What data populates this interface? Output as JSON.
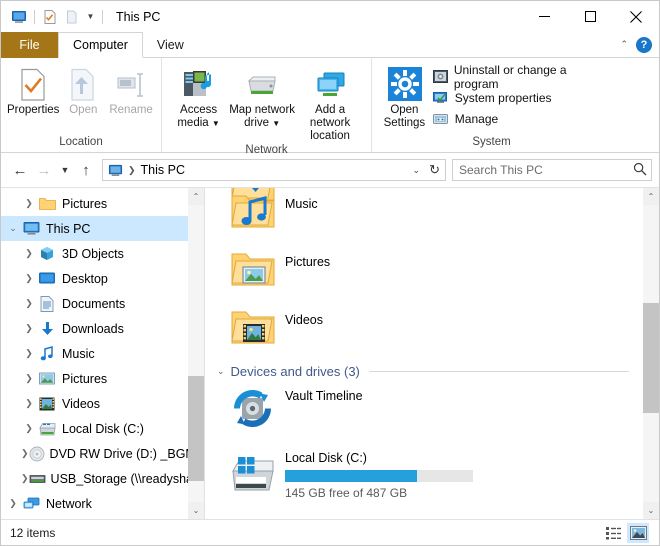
{
  "window": {
    "title": "This PC",
    "quick_access": [
      {
        "name": "this-pc-icon",
        "label": "This PC"
      },
      {
        "name": "properties-icon",
        "label": "Properties"
      },
      {
        "name": "new-folder-icon",
        "label": "New folder"
      }
    ],
    "controls": {
      "minimize": "Minimize",
      "maximize": "Maximize",
      "close": "Close"
    }
  },
  "tabs": [
    {
      "label": "File",
      "type": "file"
    },
    {
      "label": "Computer",
      "type": "active"
    },
    {
      "label": "View",
      "type": "normal"
    }
  ],
  "tab_right": {
    "collapse_label": "Collapse the Ribbon",
    "help_label": "?"
  },
  "ribbon": {
    "groups": [
      {
        "label": "Location",
        "buttons": [
          {
            "label": "Properties",
            "icon": "properties-icon",
            "disabled": false
          },
          {
            "label": "Open",
            "icon": "open-icon",
            "disabled": true
          },
          {
            "label": "Rename",
            "icon": "rename-icon",
            "disabled": true
          }
        ]
      },
      {
        "label": "Network",
        "buttons": [
          {
            "label": "Access media",
            "icon": "access-media-icon",
            "dropdown": true,
            "disabled": false
          },
          {
            "label": "Map network drive",
            "icon": "map-network-drive-icon",
            "dropdown": true,
            "disabled": false
          },
          {
            "label": "Add a network location",
            "icon": "add-network-location-icon",
            "dropdown": false,
            "disabled": false
          }
        ]
      },
      {
        "label": "System",
        "big_button": {
          "label_line1": "Open",
          "label_line2": "Settings",
          "icon": "gear-icon"
        },
        "small_buttons": [
          {
            "label": "Uninstall or change a program",
            "icon": "uninstall-icon"
          },
          {
            "label": "System properties",
            "icon": "system-properties-icon"
          },
          {
            "label": "Manage",
            "icon": "manage-icon"
          }
        ]
      }
    ]
  },
  "addressbar": {
    "back": "Back",
    "forward": "Forward",
    "recent": "Recent locations",
    "up": "Up",
    "breadcrumb_icon": "this-pc-icon",
    "breadcrumb": "This PC",
    "refresh": "Refresh",
    "search_placeholder": "Search This PC"
  },
  "navpane": {
    "items": [
      {
        "label": "Pictures",
        "icon": "folder-icon",
        "depth": 1,
        "expander": "collapsed",
        "selected": false
      },
      {
        "label": "This PC",
        "icon": "this-pc-icon",
        "depth": 0,
        "expander": "expanded",
        "selected": true
      },
      {
        "label": "3D Objects",
        "icon": "3d-objects-icon",
        "depth": 1,
        "expander": "collapsed",
        "selected": false
      },
      {
        "label": "Desktop",
        "icon": "desktop-icon",
        "depth": 1,
        "expander": "collapsed",
        "selected": false
      },
      {
        "label": "Documents",
        "icon": "documents-icon",
        "depth": 1,
        "expander": "collapsed",
        "selected": false
      },
      {
        "label": "Downloads",
        "icon": "downloads-icon",
        "depth": 1,
        "expander": "collapsed",
        "selected": false
      },
      {
        "label": "Music",
        "icon": "music-icon",
        "depth": 1,
        "expander": "collapsed",
        "selected": false
      },
      {
        "label": "Pictures",
        "icon": "pictures-icon",
        "depth": 1,
        "expander": "collapsed",
        "selected": false
      },
      {
        "label": "Videos",
        "icon": "videos-icon",
        "depth": 1,
        "expander": "collapsed",
        "selected": false
      },
      {
        "label": "Local Disk (C:)",
        "icon": "drive-icon",
        "depth": 1,
        "expander": "collapsed",
        "selected": false
      },
      {
        "label": "DVD RW Drive (D:) _BGMC_V",
        "icon": "dvd-drive-icon",
        "depth": 1,
        "expander": "collapsed",
        "selected": false
      },
      {
        "label": "USB_Storage (\\\\readyshare)",
        "icon": "network-drive-icon",
        "depth": 1,
        "expander": "collapsed",
        "selected": false
      },
      {
        "label": "Network",
        "icon": "network-icon",
        "depth": 0,
        "expander": "collapsed",
        "selected": false
      }
    ]
  },
  "content": {
    "folders": [
      {
        "label": "",
        "icon": "downloads-folder-icon",
        "partial": true
      },
      {
        "label": "Music",
        "icon": "music-folder-icon",
        "partial": false
      },
      {
        "label": "Pictures",
        "icon": "pictures-folder-icon",
        "partial": false
      },
      {
        "label": "Videos",
        "icon": "videos-folder-icon",
        "partial": false
      }
    ],
    "group_header": "Devices and drives (3)",
    "drives": [
      {
        "label": "Vault Timeline",
        "icon": "vault-timeline-icon",
        "has_bar": false,
        "free_text": "",
        "used_percent": 0
      },
      {
        "label": "Local Disk (C:)",
        "icon": "local-disk-icon",
        "has_bar": true,
        "free_text": "145 GB free of 487 GB",
        "used_percent": 70
      }
    ]
  },
  "statusbar": {
    "item_count": "12 items",
    "views": [
      {
        "name": "details-view-button",
        "label": "Details view",
        "active": false
      },
      {
        "name": "large-icons-view-button",
        "label": "Large icons view",
        "active": true
      }
    ]
  },
  "colors": {
    "file_tab": "#a47617",
    "selection": "#cce8ff",
    "accent_blue": "#0078d7",
    "progress_blue": "#26a0da",
    "group_header": "#3f5a8a"
  }
}
